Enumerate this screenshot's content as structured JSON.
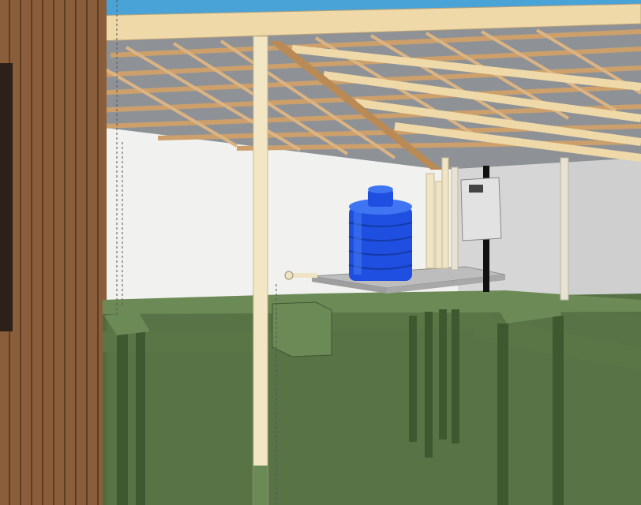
{
  "scene": {
    "colors": {
      "sky": "#4aa3d6",
      "back_wall": "#f1f1ef",
      "right_wall": "#cfcfcf",
      "roof_sheet": "#8e9296",
      "roof_beam": "#efd9a8",
      "rafter": "#cda06b",
      "timber_wall": "#8a5e3b",
      "timber_groove": "#5c3d25",
      "tank_blue": "#1f4fe0",
      "tank_highlight": "#3f74f2",
      "platform": "#bdbdbd",
      "post": "#f3e6c5",
      "green_water": "#4f6b3c",
      "green_dark": "#3e5830",
      "green_light": "#6c8a56",
      "panel": "#e2e2e2",
      "pipe": "#f0e4c6"
    },
    "icons": {
      "tank": "water-tank-icon",
      "panel": "electrical-panel-icon"
    }
  }
}
